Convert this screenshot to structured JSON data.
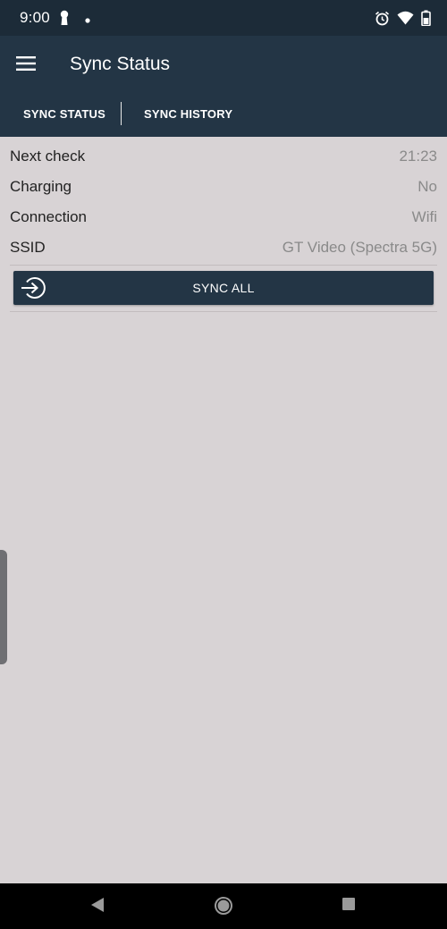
{
  "status_bar": {
    "time": "9:00",
    "icons": [
      "keyhole-icon",
      "dot-icon",
      "alarm-icon",
      "wifi-icon",
      "battery-icon"
    ]
  },
  "app_bar": {
    "title": "Sync Status",
    "menu_icon": "hamburger-menu-icon"
  },
  "tabs": [
    {
      "label": "SYNC STATUS"
    },
    {
      "label": "SYNC HISTORY"
    }
  ],
  "info_rows": [
    {
      "label": "Next check",
      "value": "21:23"
    },
    {
      "label": "Charging",
      "value": "No"
    },
    {
      "label": "Connection",
      "value": "Wifi"
    },
    {
      "label": "SSID",
      "value": "GT Video (Spectra 5G)"
    }
  ],
  "sync_button": {
    "label": "SYNC ALL",
    "icon": "sign-in-arrow-icon"
  },
  "nav_bar": {
    "buttons": [
      "back-triangle-icon",
      "home-circle-icon",
      "recent-square-icon"
    ]
  },
  "colors": {
    "status_bar": "#1c2b38",
    "app_bar": "#233545",
    "background": "#d8d3d5",
    "value_text": "#8a8a8a"
  }
}
